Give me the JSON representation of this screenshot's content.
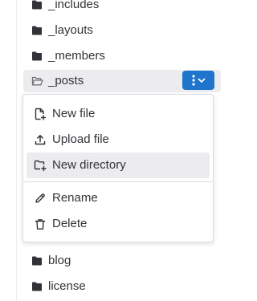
{
  "tree": {
    "items_before": [
      {
        "label": "_includes",
        "icon": "folder-icon"
      },
      {
        "label": "_layouts",
        "icon": "folder-icon"
      },
      {
        "label": "_members",
        "icon": "folder-icon"
      }
    ],
    "active_item": {
      "label": "_posts",
      "icon": "folder-open-icon"
    },
    "items_after": [
      {
        "label": "blog",
        "icon": "folder-icon"
      },
      {
        "label": "license",
        "icon": "folder-icon"
      }
    ]
  },
  "actions_button": {
    "icons": [
      "ellipsis-v-icon",
      "chevron-down-icon"
    ],
    "color": "#1f75cb"
  },
  "menu": {
    "create_items": [
      {
        "label": "New file",
        "icon": "doc-new-icon"
      },
      {
        "label": "Upload file",
        "icon": "upload-icon"
      },
      {
        "label": "New directory",
        "icon": "folder-new-icon"
      }
    ],
    "edit_items": [
      {
        "label": "Rename",
        "icon": "pencil-icon"
      },
      {
        "label": "Delete",
        "icon": "remove-icon"
      }
    ]
  }
}
